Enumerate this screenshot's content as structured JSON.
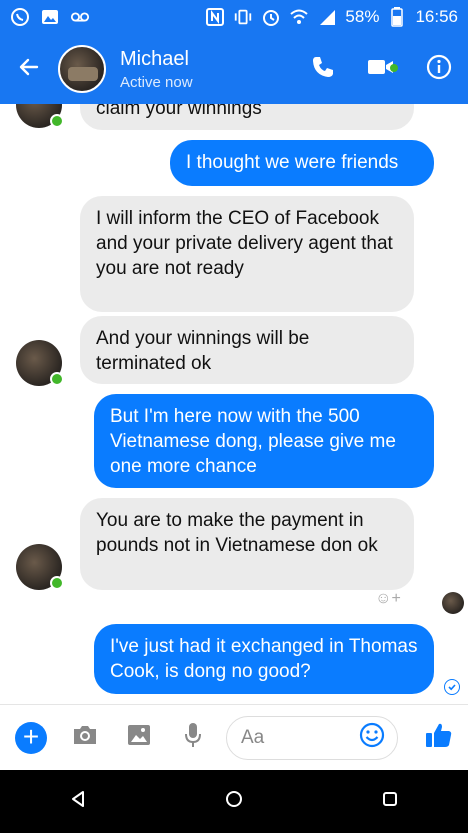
{
  "status_bar": {
    "battery": "58%",
    "time": "16:56"
  },
  "header": {
    "name": "Michael",
    "status": "Active now"
  },
  "messages": [
    {
      "side": "in",
      "text": "claim your winnings"
    },
    {
      "side": "out",
      "text": "I thought we were friends"
    },
    {
      "side": "in",
      "text": "I will inform the CEO of Facebook and your private delivery agent that you are not ready"
    },
    {
      "side": "in",
      "text": "And your winnings will be terminated ok"
    },
    {
      "side": "out",
      "text": "But I'm here now with the 500 Vietnamese dong, please give me one more chance"
    },
    {
      "side": "in",
      "text": "You are to make the payment in pounds not in Vietnamese don ok"
    },
    {
      "side": "out",
      "text": "I've just had it exchanged in Thomas Cook, is dong no good?"
    }
  ],
  "composer": {
    "placeholder": "Aa"
  },
  "colors": {
    "brand_blue": "#1877f2",
    "message_blue": "#0a7cff",
    "incoming_gray": "#ebebeb",
    "online_green": "#42b72a"
  },
  "icons": [
    "whatsapp-icon",
    "gallery-icon",
    "voicemail-icon",
    "nfc-icon",
    "vibrate-icon",
    "alarm-icon",
    "wifi-icon",
    "signal-icon",
    "battery-icon",
    "back-arrow-icon",
    "phone-icon",
    "video-camera-icon",
    "info-icon",
    "plus-icon",
    "camera-icon",
    "image-icon",
    "microphone-icon",
    "emoji-icon",
    "thumbs-up-icon",
    "nav-back-icon",
    "nav-home-icon",
    "nav-recents-icon"
  ]
}
